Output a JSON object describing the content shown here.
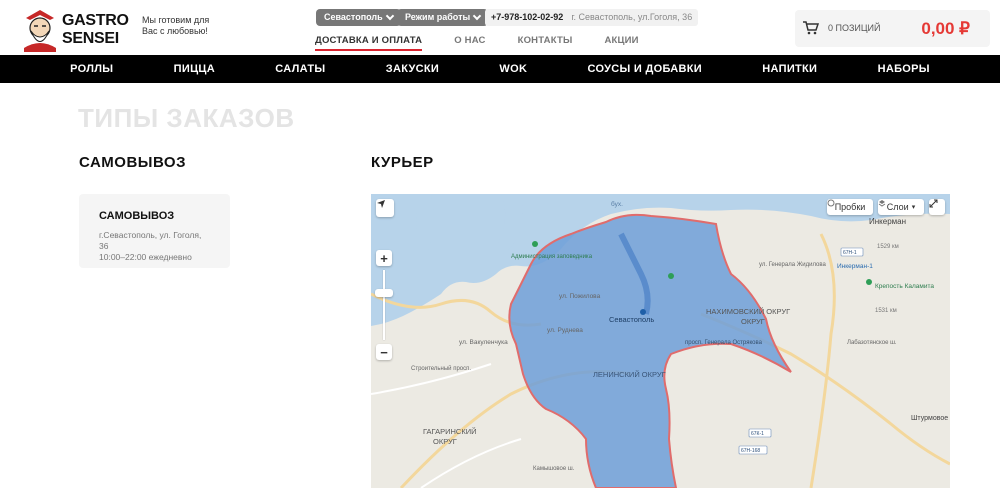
{
  "brand": {
    "line1": "GASTRO",
    "line2": "SENSEI",
    "tagline": "Мы готовим для Вас с любовью!"
  },
  "header": {
    "city": "Севастополь",
    "work_mode": "Режим работы",
    "phone": "+7-978-102-02-92",
    "address": "г. Севастополь, ул.Гоголя, 36"
  },
  "topnav": [
    "ДОСТАВКА И ОПЛАТА",
    "О НАС",
    "КОНТАКТЫ",
    "АКЦИИ"
  ],
  "cart": {
    "count": "0 ПОЗИЦИЙ",
    "sum": "0,00 ₽"
  },
  "mainnav": [
    "РОЛЛЫ",
    "ПИЦЦА",
    "САЛАТЫ",
    "ЗАКУСКИ",
    "WOK",
    "СОУСЫ И ДОБАВКИ",
    "НАПИТКИ",
    "НАБОРЫ"
  ],
  "page": {
    "title": "ТИПЫ ЗАКАЗОВ",
    "pickup_heading": "САМОВЫВОЗ",
    "courier_heading": "КУРЬЕР"
  },
  "pickup_card": {
    "title": "САМОВЫВОЗ",
    "address": "г.Севастополь, ул. Гоголя, 36",
    "hours": "10:00–22:00 ежедневно"
  },
  "map": {
    "traffic_label": "Пробки",
    "layers_label": "Слои",
    "labels": {
      "nakhimov": "НАХИМОВСКИЙ ОКРУГ",
      "nakhimov2": "ОКРУГ",
      "lenin": "ЛЕНИНСКИЙ ОКРУГ",
      "gagarin": "ГАГАРИНСКИЙ",
      "gagarin2": "ОКРУГ",
      "sevastopol": "Севастополь",
      "admin": "Администрация заповедника",
      "inkerman": "Инкерман",
      "inkerman1": "Инкерман-1",
      "kalamita": "Крепость Каламита",
      "shturmovoe": "Штурмовое",
      "bukh": "бух.",
      "rudneva": "ул. Руднева",
      "vakulenchuka": "ул. Вакуленчука",
      "pozhilova": "ул. Пожилова",
      "gen_zhidilova": "ул. Генерала Жидилова",
      "stroitelny": "Строительный просп.",
      "kamyshovoe": "Камышовое ш.",
      "ostryakova": "просп. Генерала Острякова",
      "labaz": "Лабазотянское ш.",
      "km1529": "1529 км",
      "km1531": "1531 км",
      "r67n": "67Н-1",
      "r67n1": "67К-1",
      "r67n168": "67Н-168"
    },
    "colors": {
      "zone_fill": "#6f9fd8",
      "zone_stroke": "#e06c6c",
      "water": "#b7d3ea",
      "land": "#eceae3"
    }
  }
}
